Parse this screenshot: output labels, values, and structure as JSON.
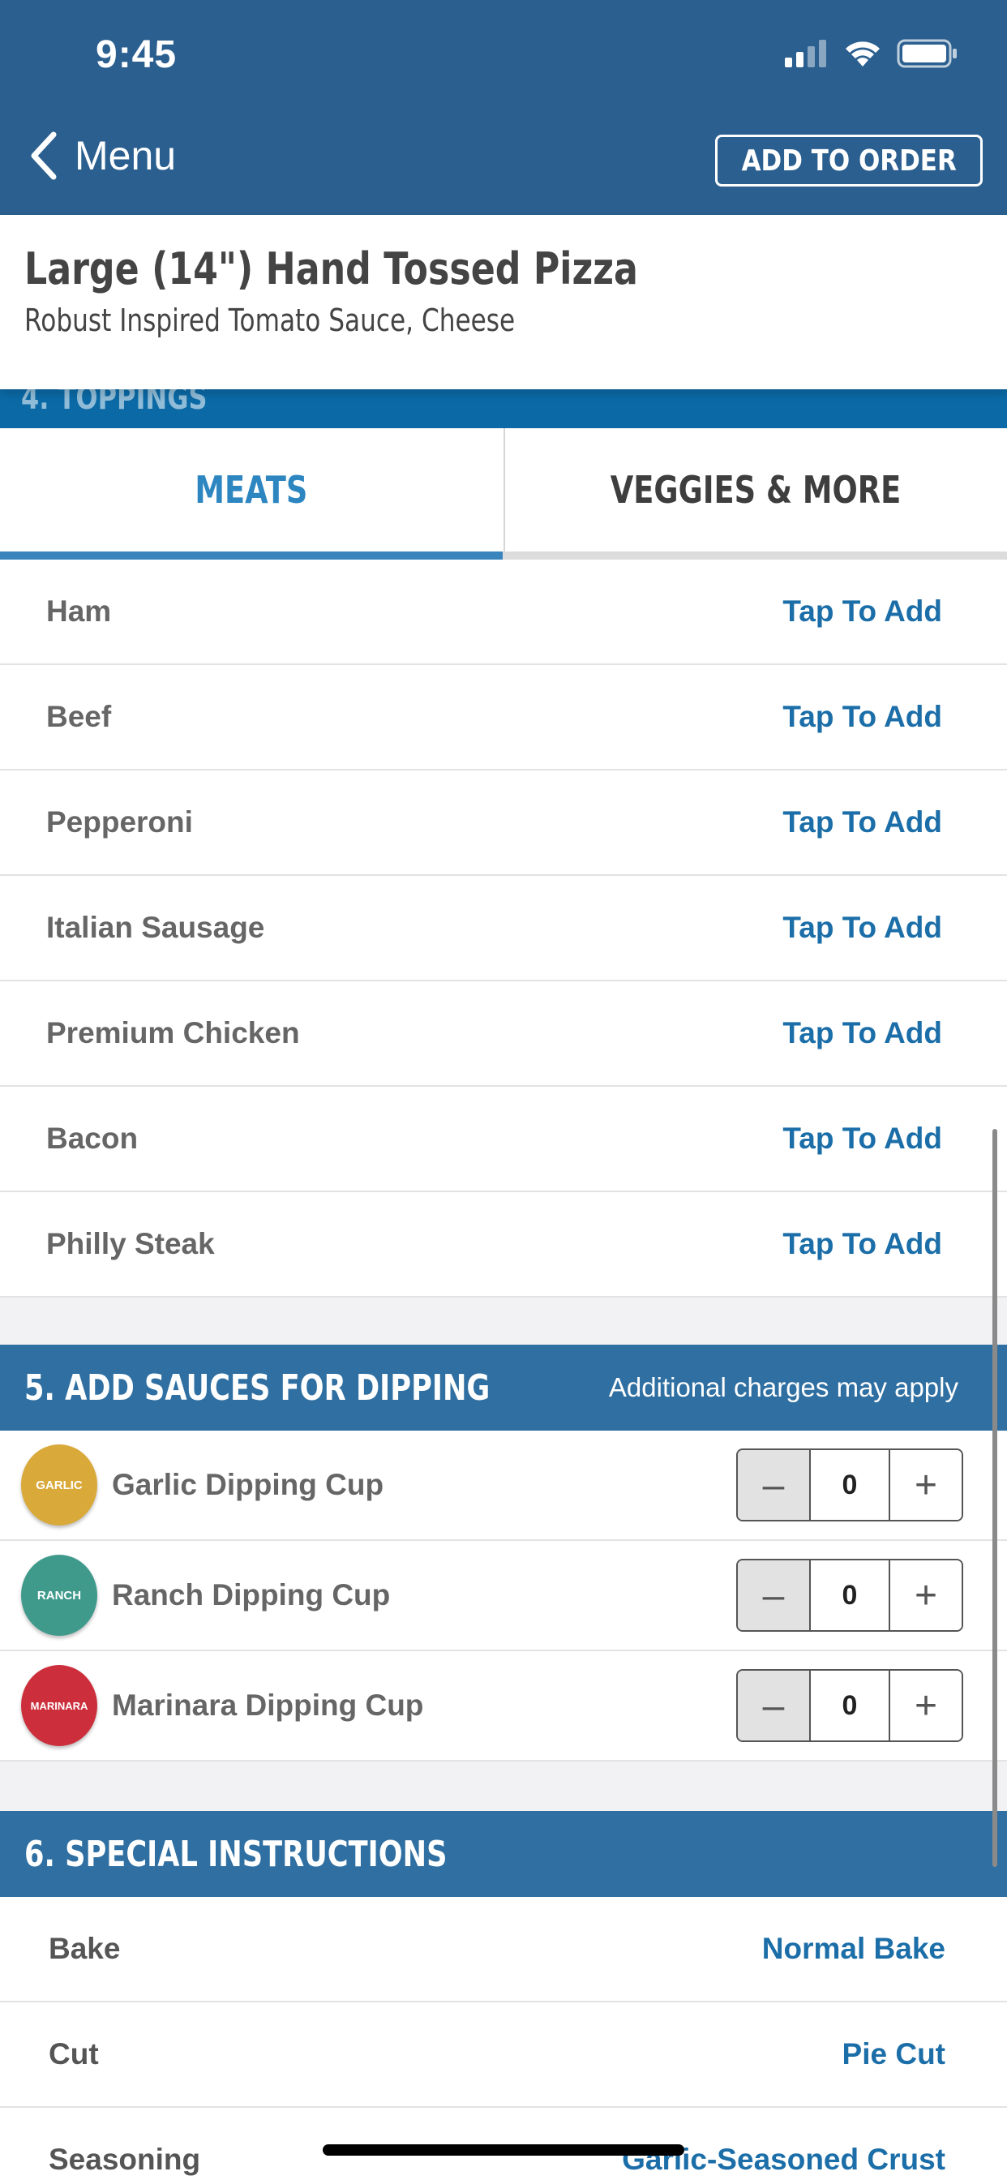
{
  "status_bar": {
    "time": "9:45"
  },
  "header": {
    "back_label": "Menu",
    "add_to_order_label": "ADD TO ORDER"
  },
  "product": {
    "title": "Large (14\") Hand Tossed Pizza",
    "description": "Robust Inspired Tomato Sauce, Cheese",
    "partial_section_label": "4. TOPPINGS"
  },
  "tabs": [
    {
      "label": "MEATS",
      "selected": true
    },
    {
      "label": "VEGGIES & MORE",
      "selected": false
    }
  ],
  "toppings": {
    "action_label": "Tap To Add",
    "items": [
      {
        "name": "Ham",
        "action": "Tap To Add"
      },
      {
        "name": "Beef",
        "action": "Tap To Add"
      },
      {
        "name": "Pepperoni",
        "action": "Tap To Add"
      },
      {
        "name": "Italian Sausage",
        "action": "Tap To Add"
      },
      {
        "name": "Premium Chicken",
        "action": "Tap To Add"
      },
      {
        "name": "Bacon",
        "action": "Tap To Add"
      },
      {
        "name": "Philly Steak",
        "action": "Tap To Add"
      }
    ]
  },
  "sauces": {
    "title": "5. ADD SAUCES FOR DIPPING",
    "note": "Additional charges may apply",
    "items": [
      {
        "name": "Garlic Dipping Cup",
        "icon_label": "GARLIC",
        "quantity": "0",
        "color": "#d9a93a"
      },
      {
        "name": "Ranch Dipping Cup",
        "icon_label": "RANCH",
        "quantity": "0",
        "color": "#3f9a8c"
      },
      {
        "name": "Marinara Dipping Cup",
        "icon_label": "MARINARA",
        "quantity": "0",
        "color": "#cc2f3b"
      }
    ]
  },
  "instructions": {
    "title": "6. SPECIAL INSTRUCTIONS",
    "items": [
      {
        "label": "Bake",
        "value": "Normal Bake"
      },
      {
        "label": "Cut",
        "value": "Pie Cut"
      },
      {
        "label": "Seasoning",
        "value": "Garlic-Seasoned Crust"
      }
    ]
  },
  "colors": {
    "header": "#2b5f8f",
    "accent": "#1b6ea8",
    "section": "#2f6fa1",
    "tab_active": "#2e86c1"
  }
}
